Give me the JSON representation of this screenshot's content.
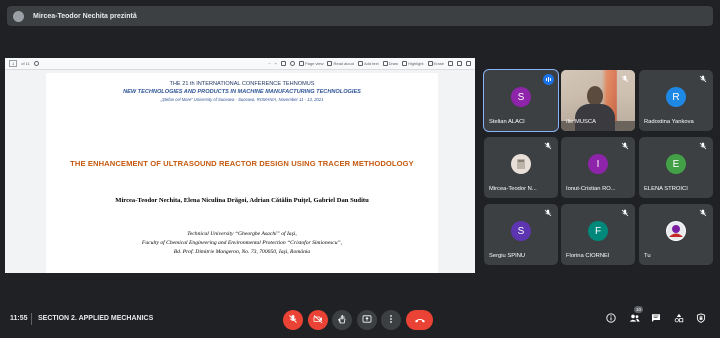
{
  "presenter": {
    "text": "Mircea-Teodor Nechita prezintă"
  },
  "pdf_toolbar": {
    "page": "1",
    "page_of": "of 11",
    "zoom_out": "−",
    "zoom_in": "+",
    "page_view": "Page view",
    "read_aloud": "Read aloud",
    "add_text": "Add text",
    "draw": "Draw",
    "highlight": "Highlight",
    "erase": "Erase"
  },
  "document": {
    "conference_line": "THE 21 th INTERNATIONAL CONFERENCE TEHNOMUS",
    "conference_theme": "NEW TECHNOLOGIES AND PRODUCTS IN MACHINE MANUFACTURING TECHNOLOGIES",
    "conference_venue": "„Ştefan cel Mare” University of Suceava - Suceava, ROMANIA, November 11 - 13, 2021",
    "title": "THE ENHANCEMENT OF ULTRASOUND REACTOR DESIGN USING TRACER METHODOLOGY",
    "authors": "Mircea-Teodor Nechita, Elena Niculina Drăgoi, Adrian Cătălin Puiţel, Gabriel Dan Suditu",
    "affiliation_1": "Technical University “Gheorghe Asachi” of Iaşi,",
    "affiliation_2": "Faculty of Chemical Engineering and Environmental Protection “Cristofor Simionescu”,",
    "affiliation_3": "Bd. Prof. Dimitrie Mangeron, No. 73, 700050, Iaşi, România"
  },
  "participants": [
    {
      "name": "Stelian ALACI",
      "initial": "S",
      "color": "#8e24aa",
      "speaking": true,
      "active": true
    },
    {
      "name": "Ilie MUSCA",
      "initial": "",
      "color": "",
      "video": true,
      "muted": true
    },
    {
      "name": "Radostina Yankova",
      "initial": "R",
      "color": "#1e88e5",
      "muted": true
    },
    {
      "name": "Mircea-Teodor N...",
      "initial": "",
      "color": "#e8e0d8",
      "muted": true,
      "photo": true
    },
    {
      "name": "Ionut-Cristian RO...",
      "initial": "I",
      "color": "#8e24aa",
      "muted": true
    },
    {
      "name": "ELENA STROICI",
      "initial": "E",
      "color": "#43a047",
      "muted": true
    },
    {
      "name": "Sergiu SPÎNU",
      "initial": "S",
      "color": "#5e35b1",
      "muted": true
    },
    {
      "name": "Florina CIORNEI",
      "initial": "F",
      "color": "#00897b",
      "muted": true
    },
    {
      "name": "Tu",
      "initial": "",
      "color": "#ffffff",
      "muted": true,
      "self": true
    }
  ],
  "bottom_bar": {
    "time": "11:55",
    "meeting": "SECTION 2. APPLIED MECHANICS",
    "participants_count": "10"
  },
  "icons": {
    "mic_off": "mic-off-icon",
    "camera_off": "camera-off-icon",
    "raise_hand": "raise-hand-icon",
    "present": "present-icon",
    "more": "more-vert-icon",
    "hangup": "call-end-icon",
    "info": "info-icon",
    "people": "people-icon",
    "chat": "chat-icon",
    "activities": "activities-icon",
    "host_controls": "lock-icon"
  }
}
